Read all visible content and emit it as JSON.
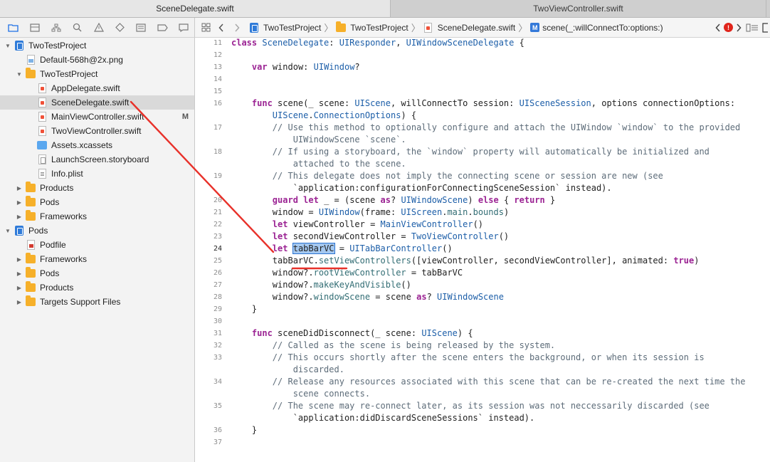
{
  "tabs": [
    {
      "label": "SceneDelegate.swift",
      "active": true
    },
    {
      "label": "TwoViewController.swift",
      "active": false
    }
  ],
  "navigator_tools": [
    "folder-icon",
    "source-control-icon",
    "hierarchy-icon",
    "search-icon",
    "warning-icon",
    "test-icon",
    "debug-icon",
    "breakpoint-icon",
    "report-icon"
  ],
  "tree": [
    {
      "label": "TwoTestProject",
      "icon": "project-icon",
      "depth": 0,
      "disclosure": "open"
    },
    {
      "label": "Default-568h@2x.png",
      "icon": "image-file-icon",
      "depth": 1,
      "disclosure": ""
    },
    {
      "label": "TwoTestProject",
      "icon": "folder-icon",
      "depth": 1,
      "disclosure": "open"
    },
    {
      "label": "AppDelegate.swift",
      "icon": "swift-file-icon",
      "depth": 2,
      "disclosure": ""
    },
    {
      "label": "SceneDelegate.swift",
      "icon": "swift-file-icon",
      "depth": 2,
      "disclosure": "",
      "selected": true
    },
    {
      "label": "MainViewController.swift",
      "icon": "swift-file-icon",
      "depth": 2,
      "disclosure": "",
      "badge": "M"
    },
    {
      "label": "TwoViewController.swift",
      "icon": "swift-file-icon",
      "depth": 2,
      "disclosure": ""
    },
    {
      "label": "Assets.xcassets",
      "icon": "assets-icon",
      "depth": 2,
      "disclosure": ""
    },
    {
      "label": "LaunchScreen.storyboard",
      "icon": "storyboard-file-icon",
      "depth": 2,
      "disclosure": ""
    },
    {
      "label": "Info.plist",
      "icon": "plist-file-icon",
      "depth": 2,
      "disclosure": ""
    },
    {
      "label": "Products",
      "icon": "folder-icon",
      "depth": 1,
      "disclosure": "closed"
    },
    {
      "label": "Pods",
      "icon": "folder-icon",
      "depth": 1,
      "disclosure": "closed"
    },
    {
      "label": "Frameworks",
      "icon": "folder-icon",
      "depth": 1,
      "disclosure": "closed"
    },
    {
      "label": "Pods",
      "icon": "project-icon",
      "depth": 0,
      "disclosure": "open"
    },
    {
      "label": "Podfile",
      "icon": "ruby-file-icon",
      "depth": 1,
      "disclosure": ""
    },
    {
      "label": "Frameworks",
      "icon": "folder-icon",
      "depth": 1,
      "disclosure": "closed"
    },
    {
      "label": "Pods",
      "icon": "folder-icon",
      "depth": 1,
      "disclosure": "closed"
    },
    {
      "label": "Products",
      "icon": "folder-icon",
      "depth": 1,
      "disclosure": "closed"
    },
    {
      "label": "Targets Support Files",
      "icon": "folder-icon",
      "depth": 1,
      "disclosure": "closed"
    }
  ],
  "jumpbar": {
    "crumbs": [
      "TwoTestProject",
      "TwoTestProject",
      "SceneDelegate.swift",
      "scene(_:willConnectTo:options:)"
    ],
    "method_badge": "M",
    "error_badge": "!"
  },
  "editor": {
    "current_line": "24",
    "lines": [
      {
        "n": "11",
        "code": "class SceneDelegate: UIResponder, UIWindowSceneDelegate {"
      },
      {
        "n": "12",
        "code": ""
      },
      {
        "n": "13",
        "code": "    var window: UIWindow?"
      },
      {
        "n": "14",
        "code": ""
      },
      {
        "n": "15",
        "code": ""
      },
      {
        "n": "16",
        "code": "    func scene(_ scene: UIScene, willConnectTo session: UISceneSession, options connectionOptions:"
      },
      {
        "n": "",
        "code": "        UIScene.ConnectionOptions) {"
      },
      {
        "n": "17",
        "code": "        // Use this method to optionally configure and attach the UIWindow `window` to the provided"
      },
      {
        "n": "",
        "code": "            UIWindowScene `scene`."
      },
      {
        "n": "18",
        "code": "        // If using a storyboard, the `window` property will automatically be initialized and"
      },
      {
        "n": "",
        "code": "            attached to the scene."
      },
      {
        "n": "19",
        "code": "        // This delegate does not imply the connecting scene or session are new (see"
      },
      {
        "n": "",
        "code": "            `application:configurationForConnectingSceneSession` instead)."
      },
      {
        "n": "20",
        "code": "        guard let _ = (scene as? UIWindowScene) else { return }"
      },
      {
        "n": "21",
        "code": "        window = UIWindow(frame: UIScreen.main.bounds)"
      },
      {
        "n": "22",
        "code": "        let viewController = MainViewController()"
      },
      {
        "n": "23",
        "code": "        let secondViewController = TwoViewController()"
      },
      {
        "n": "24",
        "code": "        let tabBarVC = UITabBarController()"
      },
      {
        "n": "25",
        "code": "        tabBarVC.setViewControllers([viewController, secondViewController], animated: true)"
      },
      {
        "n": "26",
        "code": "        window?.rootViewController = tabBarVC"
      },
      {
        "n": "27",
        "code": "        window?.makeKeyAndVisible()"
      },
      {
        "n": "28",
        "code": "        window?.windowScene = scene as? UIWindowScene"
      },
      {
        "n": "29",
        "code": "    }"
      },
      {
        "n": "30",
        "code": ""
      },
      {
        "n": "31",
        "code": "    func sceneDidDisconnect(_ scene: UIScene) {"
      },
      {
        "n": "32",
        "code": "        // Called as the scene is being released by the system."
      },
      {
        "n": "33",
        "code": "        // This occurs shortly after the scene enters the background, or when its session is"
      },
      {
        "n": "",
        "code": "            discarded."
      },
      {
        "n": "34",
        "code": "        // Release any resources associated with this scene that can be re-created the next time the"
      },
      {
        "n": "",
        "code": "            scene connects."
      },
      {
        "n": "35",
        "code": "        // The scene may re-connect later, as its session was not neccessarily discarded (see"
      },
      {
        "n": "",
        "code": "            `application:didDiscardSceneSessions` instead)."
      },
      {
        "n": "36",
        "code": "    }"
      },
      {
        "n": "37",
        "code": ""
      }
    ],
    "selected_word": "tabBarVC"
  },
  "annotation_color": "#e8312a"
}
